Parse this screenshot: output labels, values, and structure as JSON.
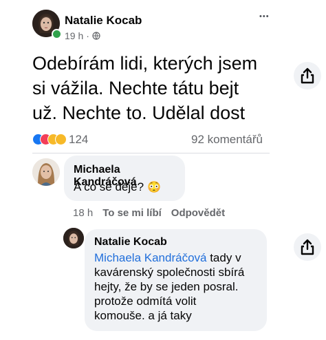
{
  "post": {
    "author": "Natalie Kocab",
    "time": "19 h",
    "separator": "·",
    "more_label": "•••",
    "text_lines": [
      "Odebírám lidi, kterých jsem",
      "si vážila. Nechte tátu bejt",
      "už. Nechte to. Udělal dost"
    ],
    "reaction_count": "124",
    "comment_count": "92 komentářů"
  },
  "comment": {
    "author": "Michaela Kandráčová",
    "text": "A co se děje?",
    "emoji": "😳",
    "time": "18 h",
    "like_label": "To se mi líbí",
    "reply_label": "Odpovědět"
  },
  "reply": {
    "author": "Natalie Kocab",
    "mention": "Michaela Kandráčová",
    "text_first": " tady v",
    "text_lines": [
      "kavárenský společnosti sbírá",
      "hejty, že by se jeden posral.",
      "protože odmítá volit",
      "komouše. a já taky"
    ]
  },
  "colors": {
    "link": "#216fdb",
    "bubble": "#f0f2f5",
    "meta": "#65676b",
    "online": "#31a24c",
    "care": "#f7b928",
    "love": "#f33e58",
    "like": "#1877f2"
  },
  "icons": [
    "globe-icon",
    "share-icon",
    "more-icon",
    "reaction-icons"
  ]
}
